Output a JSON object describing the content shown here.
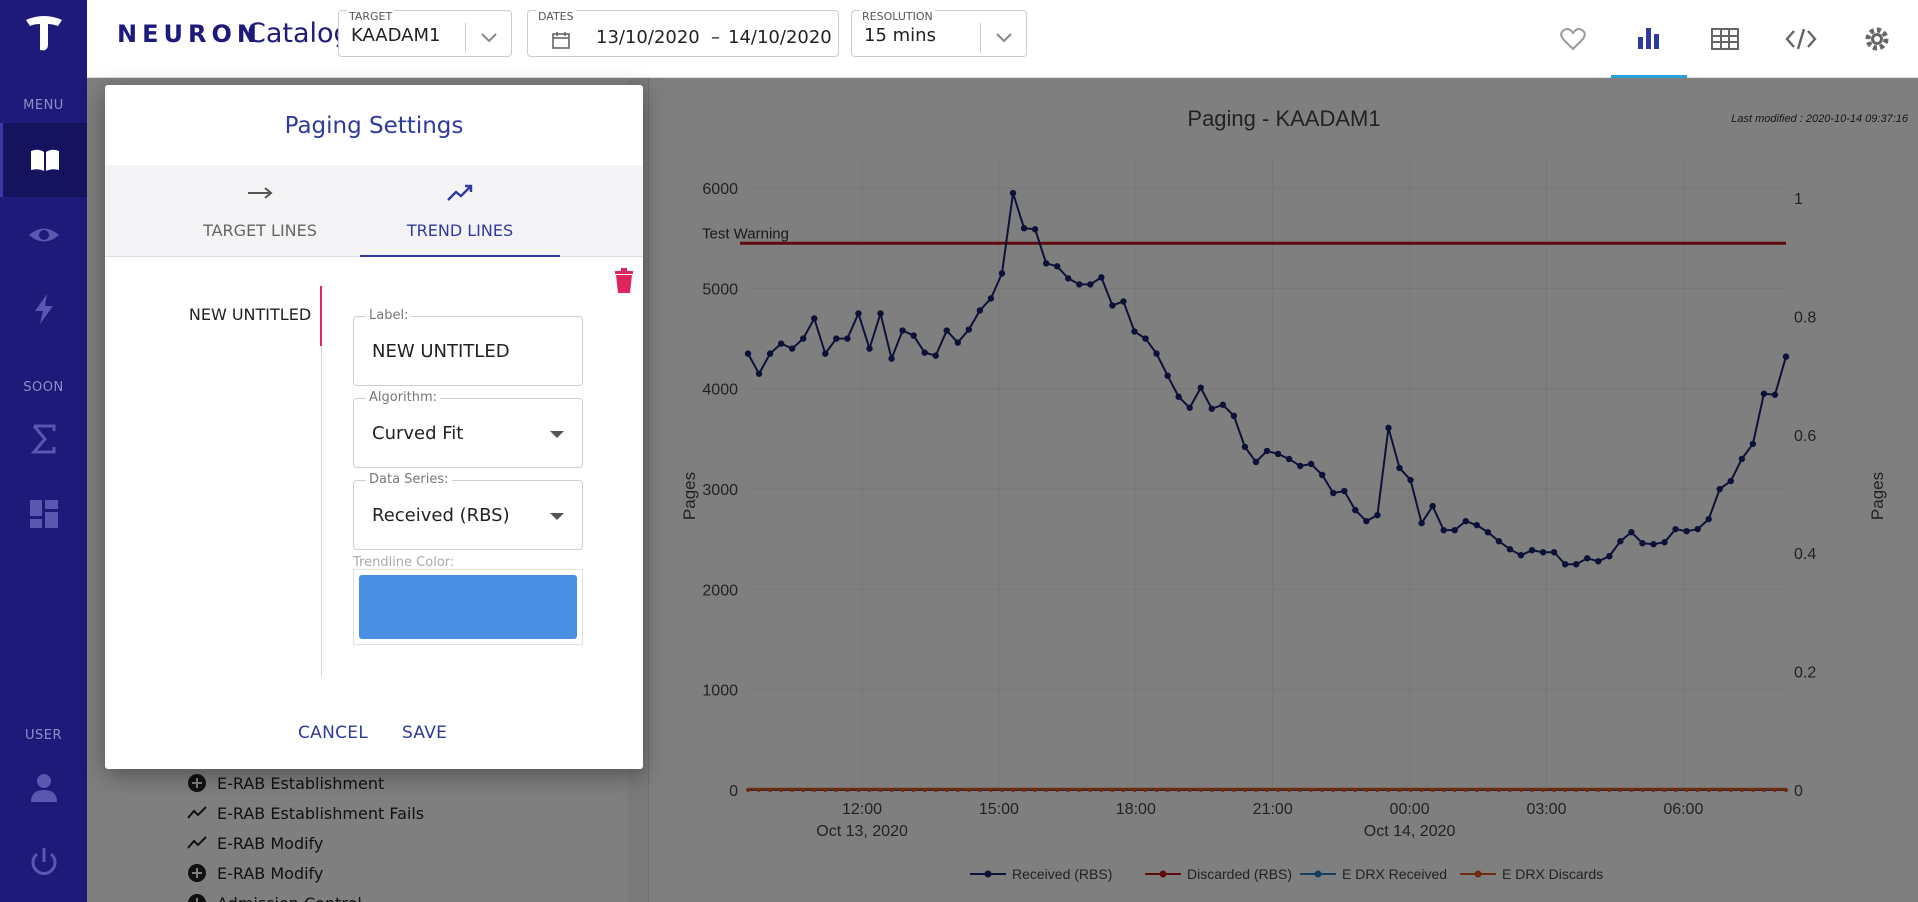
{
  "nav": {
    "sections": {
      "menu": "MENU",
      "soon": "SOON",
      "user": "USER"
    }
  },
  "topbar": {
    "brand": "NEURON",
    "brand_sub": "Catalog",
    "target": {
      "label": "TARGET",
      "value": "KAADAM1"
    },
    "dates": {
      "label": "DATES",
      "start": "13/10/2020",
      "separator": "–",
      "end": "14/10/2020"
    },
    "resolution": {
      "label": "RESOLUTION",
      "value": "15 mins"
    }
  },
  "side_list": [
    {
      "icon": "plus-circle-icon",
      "label": "E-RAB Establishment"
    },
    {
      "icon": "trend-icon",
      "label": "E-RAB Establishment Fails"
    },
    {
      "icon": "trend-icon",
      "label": "E-RAB Modify"
    },
    {
      "icon": "plus-circle-icon",
      "label": "E-RAB Modify"
    },
    {
      "icon": "plus-circle-icon",
      "label": "Admission Control"
    }
  ],
  "chart_data": {
    "type": "line",
    "title": "Paging - KAADAM1",
    "last_modified": "Last modified : 2020-10-14 09:37:16",
    "ylabel": "Pages",
    "y2label": "Pages",
    "ylim": [
      0,
      6300
    ],
    "y_ticks": [
      0,
      1000,
      2000,
      3000,
      4000,
      5000,
      6000
    ],
    "y2lim": [
      0,
      1
    ],
    "y2_ticks": [
      "0",
      "0.2",
      "0.4",
      "0.6",
      "0.8",
      "1"
    ],
    "x_ticks": [
      {
        "label": "12:00",
        "sub": "Oct 13, 2020",
        "hour": 12
      },
      {
        "label": "15:00",
        "sub": "",
        "hour": 15
      },
      {
        "label": "18:00",
        "sub": "",
        "hour": 18
      },
      {
        "label": "21:00",
        "sub": "",
        "hour": 21
      },
      {
        "label": "00:00",
        "sub": "Oct 14, 2020",
        "hour": 24
      },
      {
        "label": "03:00",
        "sub": "",
        "hour": 27
      },
      {
        "label": "06:00",
        "sub": "",
        "hour": 30
      }
    ],
    "x_start_hour": 9.5,
    "x_end_hour": 32.25,
    "target_line": {
      "label": "Test Warning",
      "value": 5450,
      "color": "#c0141c"
    },
    "series": [
      {
        "name": "Received (RBS)",
        "color": "#1a2370",
        "values": [
          4350,
          4150,
          4350,
          4450,
          4400,
          4500,
          4700,
          4350,
          4500,
          4500,
          4750,
          4400,
          4750,
          4300,
          4580,
          4530,
          4360,
          4330,
          4580,
          4460,
          4590,
          4780,
          4900,
          5150,
          5950,
          5600,
          5590,
          5250,
          5220,
          5100,
          5040,
          5040,
          5110,
          4830,
          4870,
          4570,
          4500,
          4350,
          4130,
          3920,
          3810,
          4010,
          3800,
          3840,
          3730,
          3420,
          3270,
          3380,
          3350,
          3300,
          3230,
          3250,
          3140,
          2960,
          2980,
          2790,
          2680,
          2740,
          3610,
          3210,
          3090,
          2660,
          2830,
          2590,
          2590,
          2680,
          2640,
          2570,
          2480,
          2400,
          2340,
          2390,
          2370,
          2370,
          2250,
          2250,
          2310,
          2280,
          2330,
          2480,
          2570,
          2460,
          2450,
          2470,
          2600,
          2580,
          2600,
          2700,
          3000,
          3080,
          3300,
          3450,
          3950,
          3940,
          4320
        ]
      },
      {
        "name": "Discarded (RBS)",
        "color": "#c0141c",
        "values": [
          0
        ]
      },
      {
        "name": "E DRX Received",
        "color": "#2a7fc0",
        "values": [
          0
        ]
      },
      {
        "name": "E DRX Discards",
        "color": "#e0541a",
        "values": [
          0
        ]
      }
    ]
  },
  "modal": {
    "title": "Paging Settings",
    "tabs": [
      {
        "label": "TARGET LINES",
        "icon": "arrow-right-icon"
      },
      {
        "label": "TREND LINES",
        "icon": "trending-up-icon"
      }
    ],
    "entry": "NEW UNTITLED",
    "label_field": {
      "label": "Label:",
      "value": "NEW UNTITLED"
    },
    "algorithm_field": {
      "label": "Algorithm:",
      "value": "Curved Fit"
    },
    "series_field": {
      "label": "Data Series:",
      "value": "Received (RBS)"
    },
    "color_label": "Trendline Color:",
    "trend_color": "#4a90e2",
    "cancel": "CANCEL",
    "save": "SAVE"
  }
}
